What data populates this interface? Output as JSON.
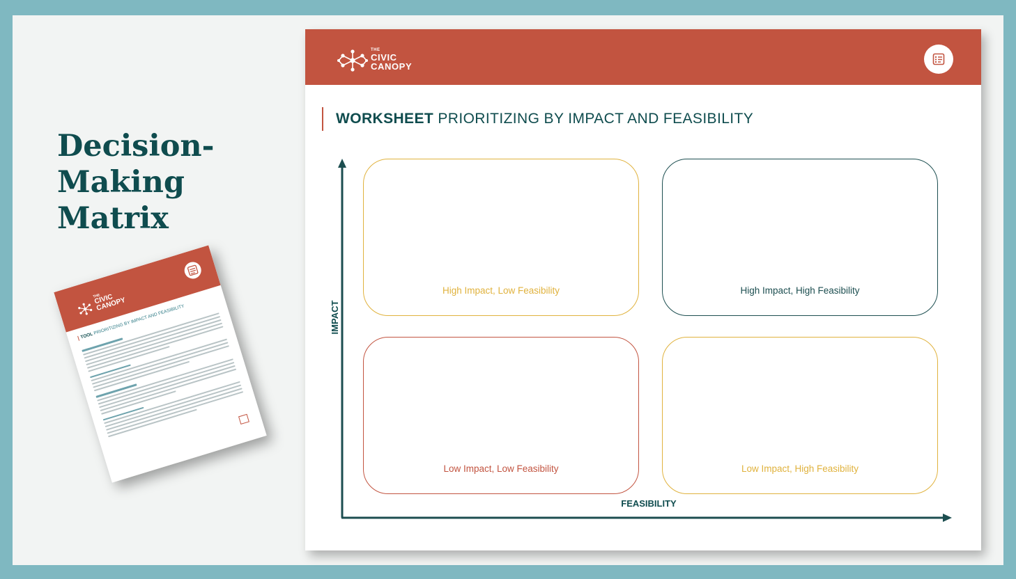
{
  "slide": {
    "title_lines": [
      "Decision-",
      "Making",
      "Matrix"
    ]
  },
  "colors": {
    "frame": "#7fb8c1",
    "header": "#c25440",
    "dark_teal": "#0f4c4e",
    "gold": "#e0b23d",
    "red": "#c25440"
  },
  "thumbnail": {
    "brand_small": "THE",
    "brand_lines": [
      "CIVIC",
      "CANOPY"
    ],
    "kind": "TOOL",
    "title": "PRIORITIZING BY IMPACT AND FEASIBILITY",
    "icon": "checklist-icon"
  },
  "worksheet": {
    "brand": {
      "small": "THE",
      "line1": "CIVIC",
      "line2": "CANOPY",
      "logo_icon": "network-logo-icon"
    },
    "header_icon": "checklist-icon",
    "kind": "WORKSHEET",
    "title": "PRIORITIZING BY IMPACT AND FEASIBILITY",
    "y_axis_label": "IMPACT",
    "x_axis_label": "FEASIBILITY",
    "quadrants": {
      "top_left": "High Impact, Low Feasibility",
      "top_right": "High Impact, High Feasibility",
      "bottom_left": "Low Impact, Low Feasibility",
      "bottom_right": "Low Impact, High Feasibility"
    }
  }
}
